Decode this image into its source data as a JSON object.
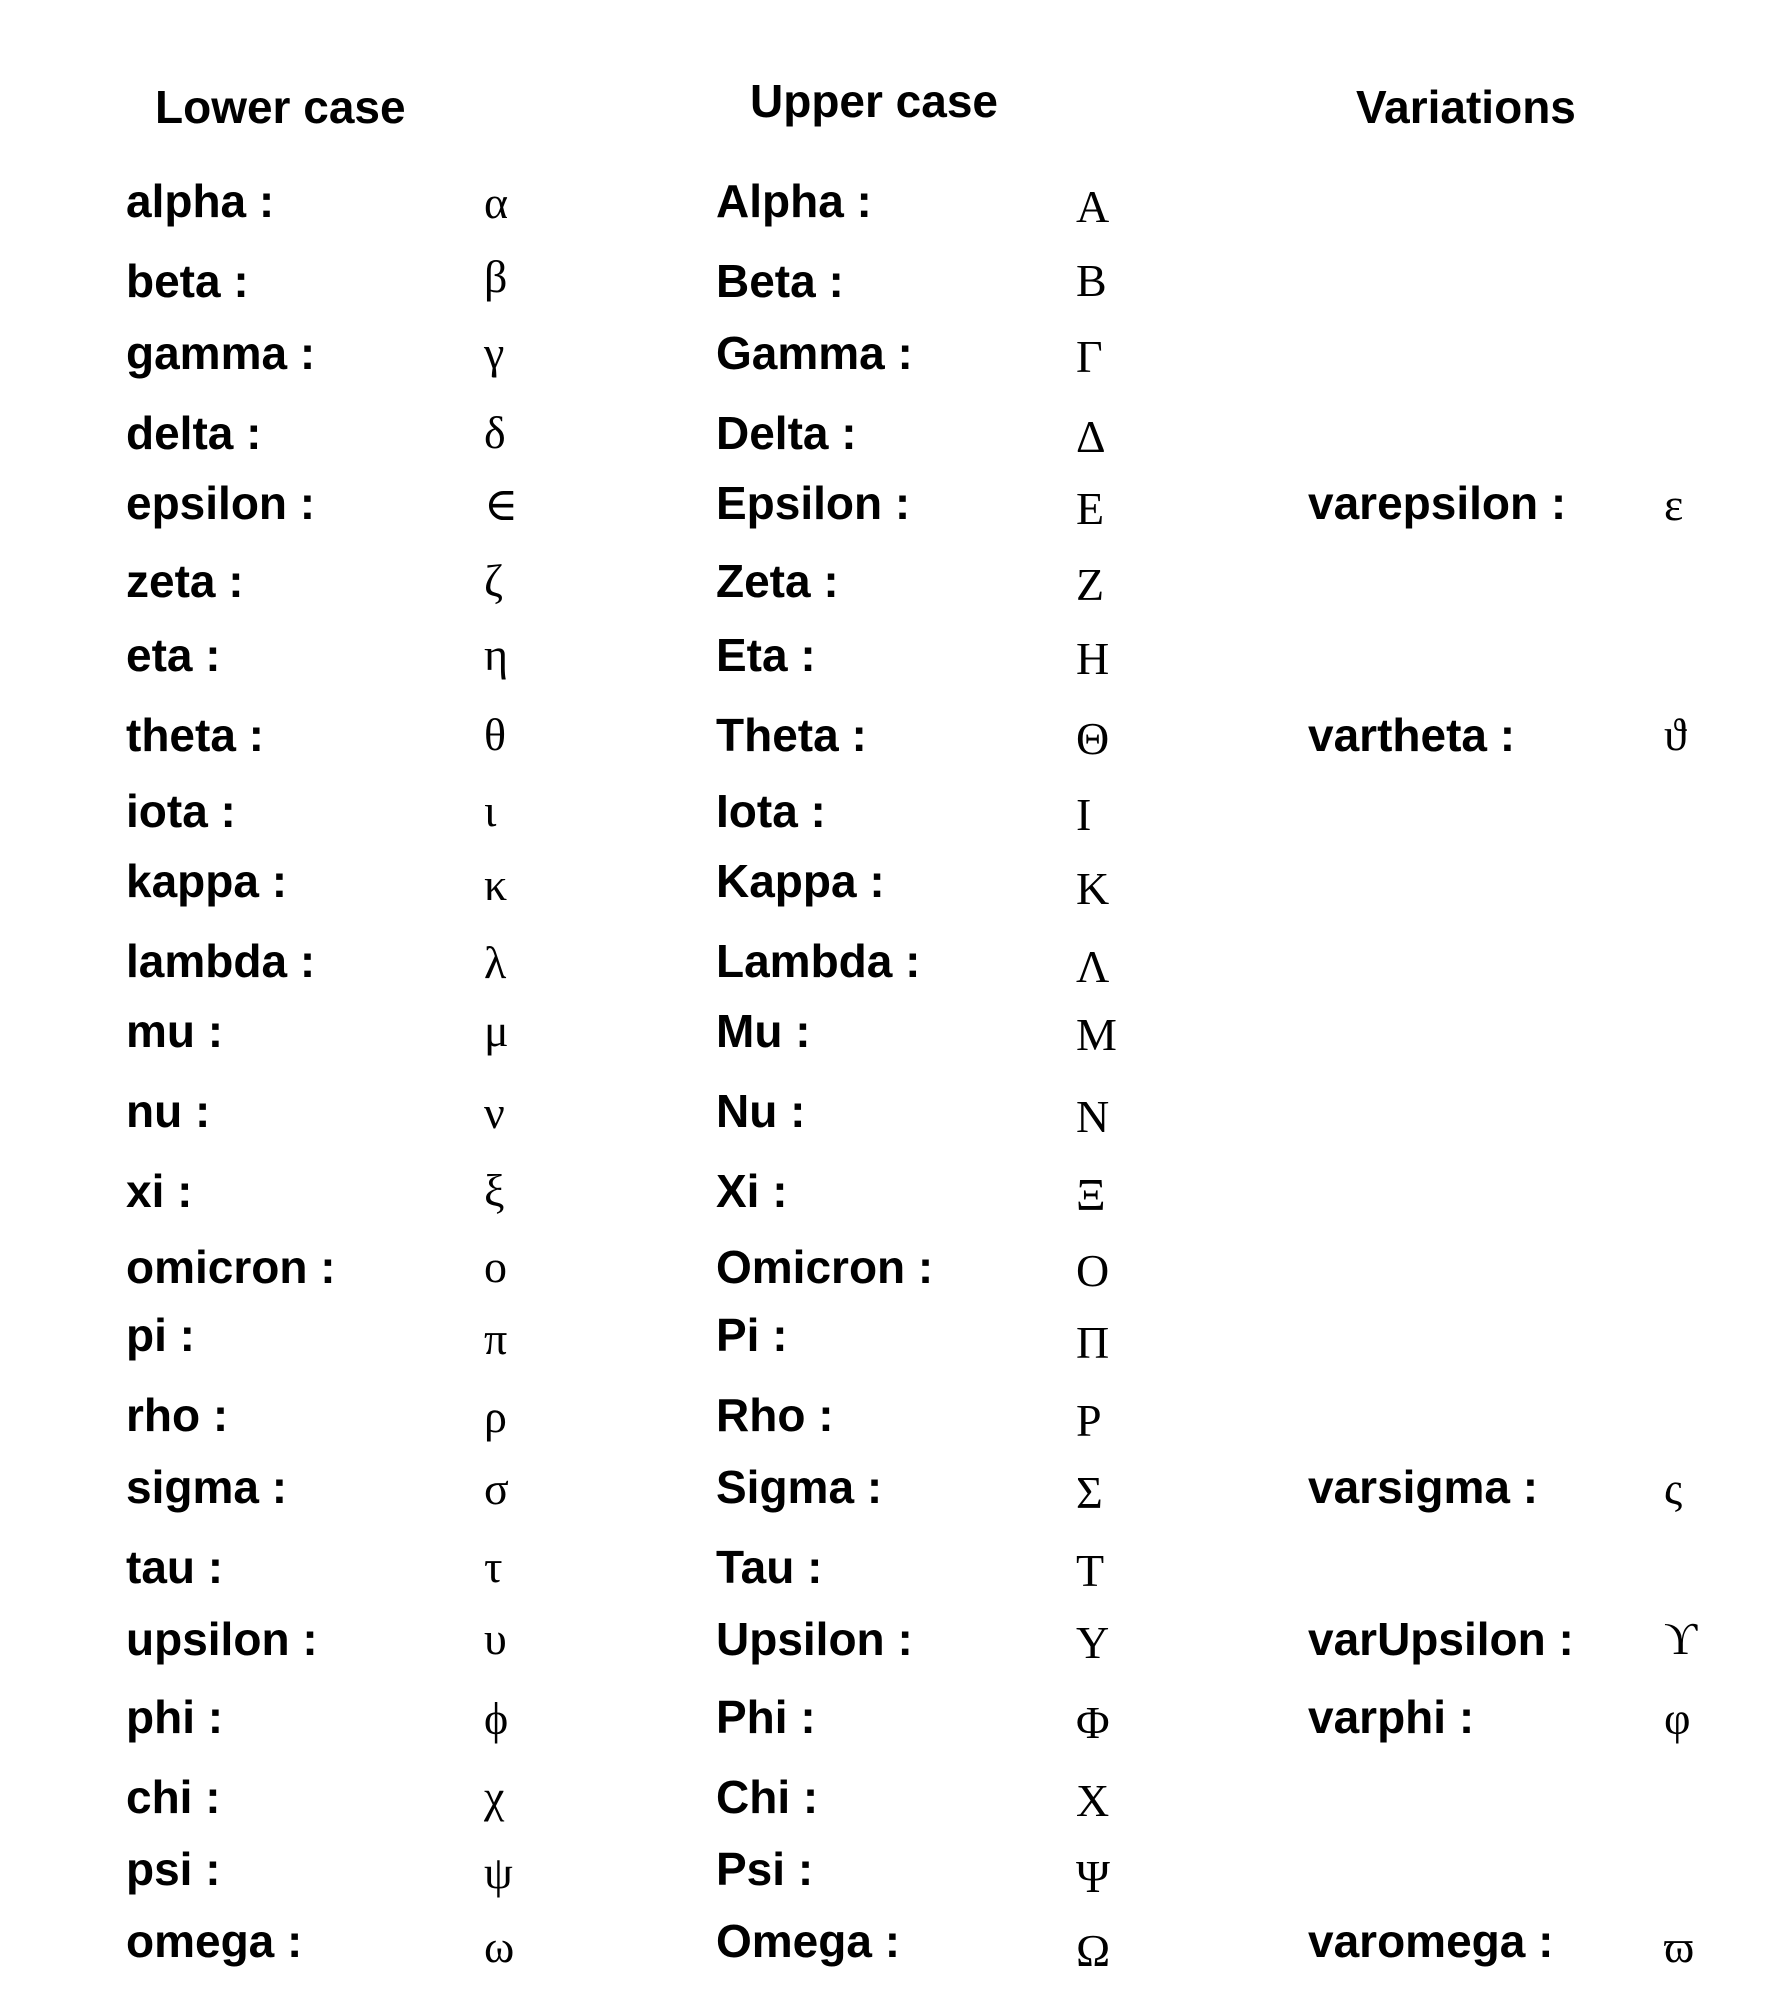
{
  "headers": {
    "lower": "Lower case",
    "upper": "Upper case",
    "variations": "Variations"
  },
  "rows": [
    {
      "lower_label": "alpha :",
      "lower_symbol": "α",
      "upper_label": "Alpha :",
      "upper_symbol": "Α",
      "var_label": "",
      "var_symbol": ""
    },
    {
      "lower_label": "beta :",
      "lower_symbol": "β",
      "upper_label": "Beta :",
      "upper_symbol": "Β",
      "var_label": "",
      "var_symbol": ""
    },
    {
      "lower_label": "gamma :",
      "lower_symbol": "γ",
      "upper_label": "Gamma :",
      "upper_symbol": "Γ",
      "var_label": "",
      "var_symbol": ""
    },
    {
      "lower_label": "delta :",
      "lower_symbol": "δ",
      "upper_label": "Delta :",
      "upper_symbol": "Δ",
      "var_label": "",
      "var_symbol": ""
    },
    {
      "lower_label": "epsilon :",
      "lower_symbol": "∈",
      "upper_label": "Epsilon :",
      "upper_symbol": "Ε",
      "var_label": "varepsilon :",
      "var_symbol": "ε"
    },
    {
      "lower_label": "zeta :",
      "lower_symbol": "ζ",
      "upper_label": "Zeta :",
      "upper_symbol": "Ζ",
      "var_label": "",
      "var_symbol": ""
    },
    {
      "lower_label": "eta :",
      "lower_symbol": "η",
      "upper_label": "Eta :",
      "upper_symbol": "Η",
      "var_label": "",
      "var_symbol": ""
    },
    {
      "lower_label": "theta :",
      "lower_symbol": "θ",
      "upper_label": "Theta :",
      "upper_symbol": "Θ",
      "var_label": "vartheta :",
      "var_symbol": "ϑ"
    },
    {
      "lower_label": "iota :",
      "lower_symbol": "ι",
      "upper_label": "Iota :",
      "upper_symbol": "Ι",
      "var_label": "",
      "var_symbol": ""
    },
    {
      "lower_label": "kappa :",
      "lower_symbol": "κ",
      "upper_label": "Kappa :",
      "upper_symbol": "Κ",
      "var_label": "",
      "var_symbol": ""
    },
    {
      "lower_label": "lambda :",
      "lower_symbol": "λ",
      "upper_label": "Lambda :",
      "upper_symbol": "Λ",
      "var_label": "",
      "var_symbol": ""
    },
    {
      "lower_label": "mu :",
      "lower_symbol": "μ",
      "upper_label": "Mu :",
      "upper_symbol": "Μ",
      "var_label": "",
      "var_symbol": ""
    },
    {
      "lower_label": "nu :",
      "lower_symbol": "ν",
      "upper_label": "Nu :",
      "upper_symbol": "Ν",
      "var_label": "",
      "var_symbol": ""
    },
    {
      "lower_label": "xi :",
      "lower_symbol": "ξ",
      "upper_label": "Xi :",
      "upper_symbol": "Ξ",
      "var_label": "",
      "var_symbol": ""
    },
    {
      "lower_label": "omicron :",
      "lower_symbol": "ο",
      "upper_label": "Omicron :",
      "upper_symbol": "Ο",
      "var_label": "",
      "var_symbol": ""
    },
    {
      "lower_label": "pi :",
      "lower_symbol": "π",
      "upper_label": "Pi :",
      "upper_symbol": "Π",
      "var_label": "",
      "var_symbol": ""
    },
    {
      "lower_label": "rho :",
      "lower_symbol": "ρ",
      "upper_label": "Rho :",
      "upper_symbol": "Ρ",
      "var_label": "",
      "var_symbol": ""
    },
    {
      "lower_label": "sigma :",
      "lower_symbol": "σ",
      "upper_label": "Sigma :",
      "upper_symbol": "Σ",
      "var_label": "varsigma :",
      "var_symbol": "ς"
    },
    {
      "lower_label": "tau :",
      "lower_symbol": "τ",
      "upper_label": "Tau :",
      "upper_symbol": "Τ",
      "var_label": "",
      "var_symbol": ""
    },
    {
      "lower_label": "upsilon :",
      "lower_symbol": "υ",
      "upper_label": "Upsilon :",
      "upper_symbol": "Υ",
      "var_label": "varUpsilon :",
      "var_symbol": "ϒ"
    },
    {
      "lower_label": "phi :",
      "lower_symbol": "ϕ",
      "upper_label": "Phi :",
      "upper_symbol": "Φ",
      "var_label": "varphi :",
      "var_symbol": "φ"
    },
    {
      "lower_label": "chi :",
      "lower_symbol": "χ",
      "upper_label": "Chi :",
      "upper_symbol": "Χ",
      "var_label": "",
      "var_symbol": ""
    },
    {
      "lower_label": "psi :",
      "lower_symbol": "ψ",
      "upper_label": "Psi :",
      "upper_symbol": "Ψ",
      "var_label": "",
      "var_symbol": ""
    },
    {
      "lower_label": "omega :",
      "lower_symbol": "ω",
      "upper_label": "Omega :",
      "upper_symbol": "Ω",
      "var_label": "varomega :",
      "var_symbol": "ϖ"
    }
  ]
}
